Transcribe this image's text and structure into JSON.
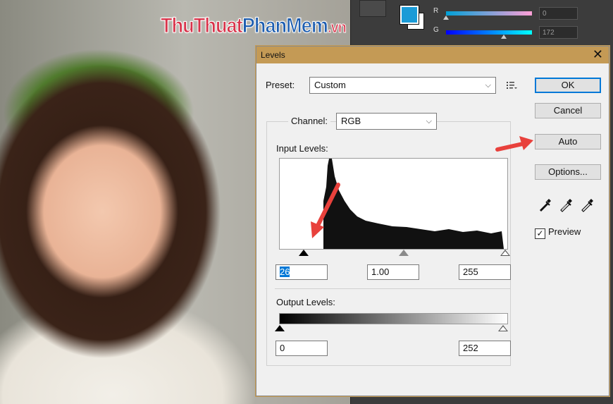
{
  "background": {
    "watermark": [
      "ThuThuat",
      "PhanMem",
      ".vn"
    ],
    "color_panel": {
      "channels": [
        {
          "label": "R",
          "value": "0",
          "gradient": [
            "#00a0d7",
            "#ff9fd7"
          ],
          "level": 0.0
        },
        {
          "label": "G",
          "value": "172",
          "gradient": [
            "#0000ff",
            "#00ffff"
          ],
          "level": 0.67
        }
      ],
      "foreground_color": "#1a9bd7",
      "background_color": "#ffffff"
    }
  },
  "dialog": {
    "title": "Levels",
    "close_label": "✕",
    "preset_label": "Preset:",
    "preset_value": "Custom",
    "channel_label": "Channel:",
    "channel_value": "RGB",
    "input_levels_label": "Input Levels:",
    "input_black": "26",
    "input_gamma": "1.00",
    "input_white": "255",
    "output_levels_label": "Output Levels:",
    "output_black": "0",
    "output_white": "252",
    "buttons": {
      "ok": "OK",
      "cancel": "Cancel",
      "auto": "Auto",
      "options": "Options..."
    },
    "preview_label": "Preview",
    "preview_checked": true,
    "eyedroppers": [
      "black-point-eyedropper",
      "gray-point-eyedropper",
      "white-point-eyedropper"
    ]
  },
  "accent_colors": {
    "titlebar": "#c49a55",
    "arrow": "#e8413c",
    "focus": "#0078d7"
  }
}
